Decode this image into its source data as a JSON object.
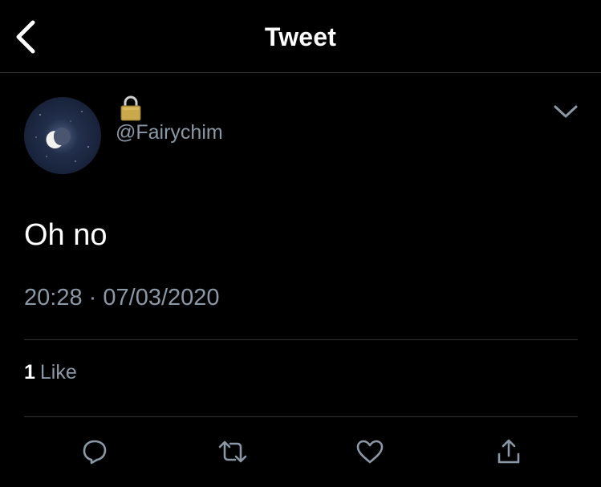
{
  "header": {
    "title": "Tweet",
    "back_icon": "chevron-left-icon"
  },
  "tweet": {
    "handle": "@Fairychim",
    "protected_icon": "lock-icon",
    "menu_icon": "chevron-down-icon",
    "text": "Oh no",
    "time": "20:28",
    "separator": "·",
    "date": "07/03/2020",
    "likes_count": "1",
    "likes_label": "Like"
  },
  "actions": [
    {
      "name": "reply",
      "icon": "reply-icon"
    },
    {
      "name": "retweet",
      "icon": "retweet-icon"
    },
    {
      "name": "like",
      "icon": "heart-icon"
    },
    {
      "name": "share",
      "icon": "share-icon"
    }
  ],
  "colors": {
    "background": "#000000",
    "text_primary": "#ffffff",
    "text_secondary": "#8b98a5",
    "divider": "#2f3336",
    "lock_body": "#c9a94b"
  }
}
